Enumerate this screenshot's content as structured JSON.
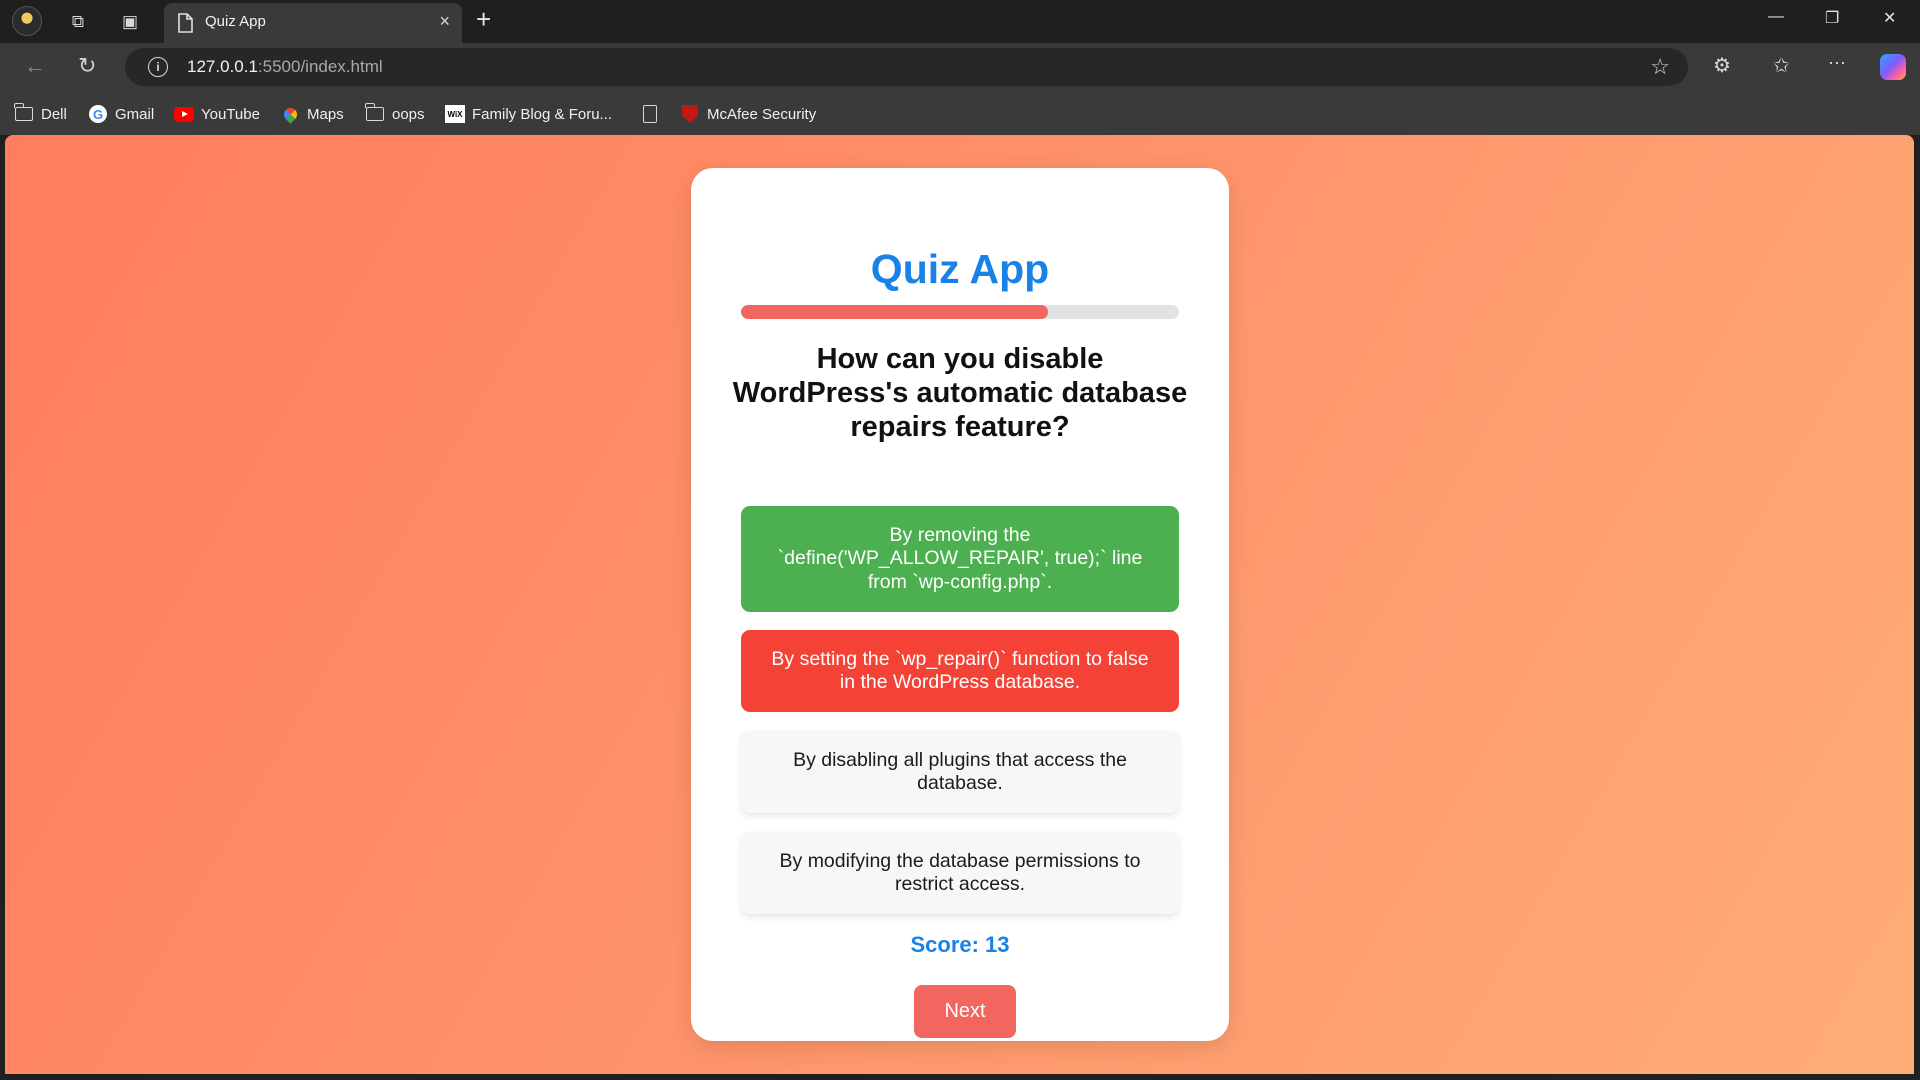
{
  "browser": {
    "tab": {
      "title": "Quiz App",
      "close_icon": "×"
    },
    "new_tab_icon": "+",
    "window_controls": {
      "minimize": "—",
      "restore": "❐",
      "close": "✕"
    },
    "address": {
      "host": "127.0.0.1",
      "rest": ":5500/index.html"
    },
    "bookmarks": [
      {
        "label": "Dell",
        "icon": "folder-icon"
      },
      {
        "label": "Gmail",
        "icon": "google-icon"
      },
      {
        "label": "YouTube",
        "icon": "youtube-icon"
      },
      {
        "label": "Maps",
        "icon": "maps-icon"
      },
      {
        "label": "oops",
        "icon": "folder-icon"
      },
      {
        "label": "Family Blog & Foru...",
        "icon": "wix-icon"
      },
      {
        "label": "",
        "icon": "page-icon"
      },
      {
        "label": "McAfee Security",
        "icon": "mcafee-icon"
      }
    ]
  },
  "quiz": {
    "title": "Quiz App",
    "progress_fraction": 0.7,
    "question": "How can you disable WordPress's automatic database repairs feature?",
    "options": [
      {
        "text": "By removing the `define('WP_ALLOW_REPAIR', true);` line from `wp-config.php`.",
        "state": "correct"
      },
      {
        "text": "By setting the `wp_repair()` function to false in the WordPress database.",
        "state": "wrong"
      },
      {
        "text": "By disabling all plugins that access the database.",
        "state": "neutral"
      },
      {
        "text": "By modifying the database permissions to restrict access.",
        "state": "neutral"
      }
    ],
    "score_text": "Score: 13",
    "next_label": "Next",
    "colors": {
      "accent": "#1a82e6",
      "progress": "#f2665f",
      "correct": "#4caf50",
      "wrong": "#f44336"
    }
  }
}
